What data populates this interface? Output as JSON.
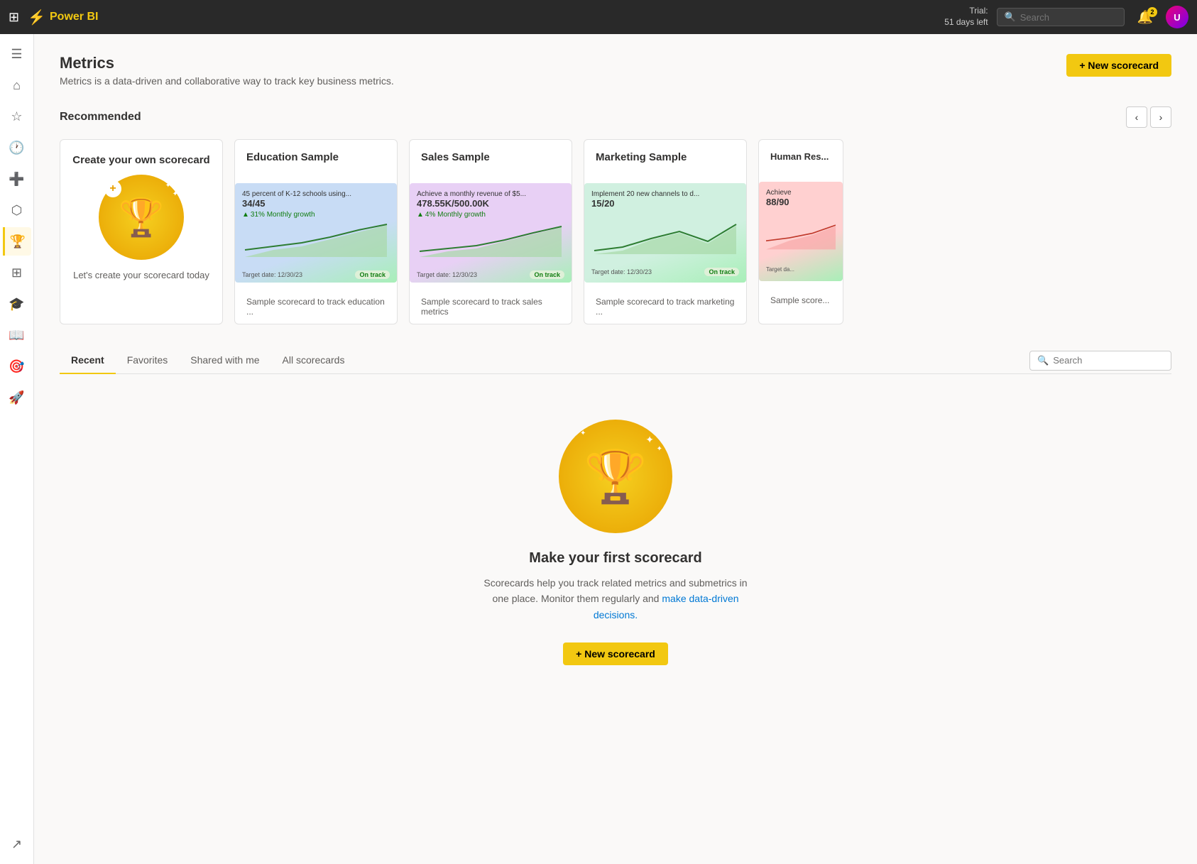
{
  "topbar": {
    "app_name": "Power BI",
    "trial_line1": "Trial:",
    "trial_line2": "51 days left",
    "search_placeholder": "Search",
    "notif_count": "2",
    "user_initials": "U"
  },
  "sidebar": {
    "items": [
      {
        "id": "menu",
        "icon": "☰",
        "label": "Expand menu"
      },
      {
        "id": "home",
        "icon": "⌂",
        "label": "Home"
      },
      {
        "id": "favorites",
        "icon": "☆",
        "label": "Favorites"
      },
      {
        "id": "recent",
        "icon": "🕐",
        "label": "Recent"
      },
      {
        "id": "create",
        "icon": "+",
        "label": "Create"
      },
      {
        "id": "data",
        "icon": "⬡",
        "label": "Data hub"
      },
      {
        "id": "metrics",
        "icon": "🏆",
        "label": "Metrics",
        "active": true
      },
      {
        "id": "apps",
        "icon": "⊞",
        "label": "Apps"
      },
      {
        "id": "learn",
        "icon": "🎓",
        "label": "Learn"
      },
      {
        "id": "book",
        "icon": "📖",
        "label": "Browse"
      },
      {
        "id": "goals",
        "icon": "🎯",
        "label": "Goals"
      },
      {
        "id": "deployment",
        "icon": "🚀",
        "label": "Deployment"
      }
    ]
  },
  "page": {
    "title": "Metrics",
    "subtitle": "Metrics is a data-driven and collaborative way to track key business metrics.",
    "new_scorecard_label": "+ New scorecard",
    "recommended_title": "Recommended"
  },
  "cards": [
    {
      "id": "create",
      "title": "Create your own scorecard",
      "desc": "Let's create your scorecard today",
      "type": "create"
    },
    {
      "id": "education",
      "title": "Education Sample",
      "type": "sample",
      "preview_class": "preview-blue",
      "metric_title": "45 percent of K-12 schools using...",
      "metric_value": "34/45",
      "growth_label": "31% Monthly growth",
      "target_date": "Target date: 12/30/23",
      "status": "On track",
      "desc": "Sample scorecard to track education ..."
    },
    {
      "id": "sales",
      "title": "Sales Sample",
      "type": "sample",
      "preview_class": "preview-purple",
      "metric_title": "Achieve a monthly revenue of $5...",
      "metric_value": "478.55K/500.00K",
      "growth_label": "4% Monthly growth",
      "target_date": "Target date: 12/30/23",
      "status": "On track",
      "desc": "Sample scorecard to track sales metrics"
    },
    {
      "id": "marketing",
      "title": "Marketing Sample",
      "type": "sample",
      "preview_class": "preview-green",
      "metric_title": "Implement 20 new channels to d...",
      "metric_value": "15/20",
      "growth_label": "",
      "target_date": "Target date: 12/30/23",
      "status": "On track",
      "desc": "Sample scorecard to track marketing ..."
    },
    {
      "id": "human",
      "title": "Human Res...",
      "type": "sample",
      "preview_class": "preview-pink",
      "metric_title": "Achieve",
      "metric_value": "88/90",
      "growth_label": "",
      "target_date": "Target da...",
      "status": "",
      "desc": "Sample score..."
    }
  ],
  "tabs": {
    "items": [
      {
        "id": "recent",
        "label": "Recent",
        "active": true
      },
      {
        "id": "favorites",
        "label": "Favorites",
        "active": false
      },
      {
        "id": "shared",
        "label": "Shared with me",
        "active": false
      },
      {
        "id": "all",
        "label": "All scorecards",
        "active": false
      }
    ],
    "search_placeholder": "Search"
  },
  "empty_state": {
    "title": "Make your first scorecard",
    "desc_part1": "Scorecards help you track related metrics and submetrics in one place. Monitor them regularly and make data-driven decisions.",
    "new_scorecard_label": "+ New scorecard"
  }
}
